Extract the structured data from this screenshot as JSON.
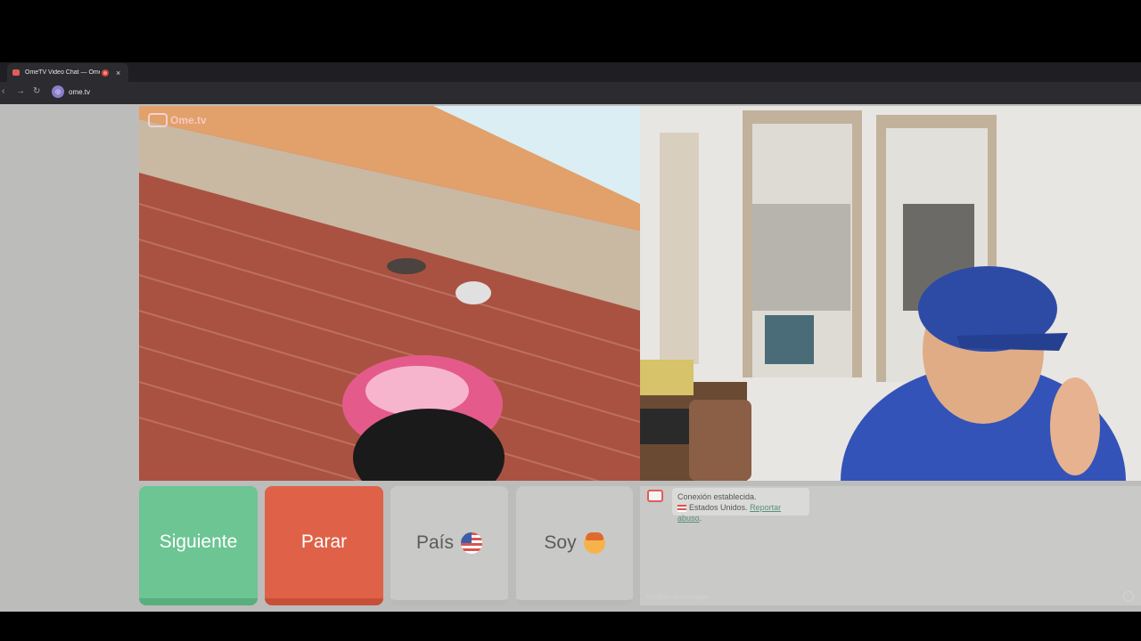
{
  "browser": {
    "tab_title": "OmeTV Video Chat — Ome",
    "tab_close": "×",
    "new_tab": "+",
    "url": "ome.tv"
  },
  "video": {
    "logo_text": "Ome.tv"
  },
  "controls": {
    "next_label": "Siguiente",
    "stop_label": "Parar",
    "country_label": "País",
    "gender_label": "Soy"
  },
  "chat": {
    "status": "Conexión establecida.",
    "location": "Estados Unidos.",
    "report_link": "Reportar abuso",
    "input_placeholder": "Escribe un mensaje"
  },
  "colors": {
    "next": "#6cc593",
    "stop": "#df6248",
    "neutral": "#c9c9c7"
  }
}
